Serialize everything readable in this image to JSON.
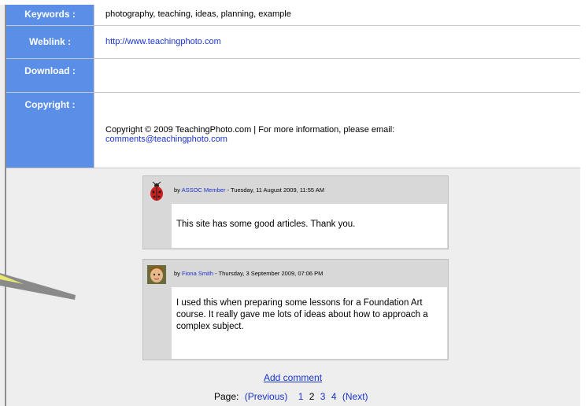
{
  "meta": {
    "rows": [
      {
        "key": "Keywords :",
        "value": "photography, teaching, ideas, planning, example"
      },
      {
        "key": "Weblink :",
        "value": "http://www.teachingphoto.com"
      },
      {
        "key": "Download :",
        "value": ""
      },
      {
        "key": "Copyright :",
        "value": "Copyright © 2009 TeachingPhoto.com | For more information, please email:",
        "link": "comments@teachingphoto.com"
      }
    ]
  },
  "comments": [
    {
      "by_prefix": "by",
      "author": "ASSOC Member",
      "date": " - Tuesday, 11 August 2009, 11:55 AM",
      "text": "This site has some good articles. Thank you.",
      "avatar_icon": "ladybug-avatar-icon"
    },
    {
      "by_prefix": "by",
      "author": "Fiona Smith",
      "date": " - Thursday, 3 September 2009, 07:06 PM",
      "text": "I used this when preparing some lessons for a Foundation Art course.  It really gave me lots of ideas about how to approach a complex subject.",
      "avatar_icon": "user-photo-avatar-icon"
    }
  ],
  "actions": {
    "add_comment": "Add comment"
  },
  "pager": {
    "label": "Page:",
    "previous": "(Previous)",
    "pages": [
      "1",
      "2",
      "3",
      "4"
    ],
    "next": "(Next)"
  },
  "colors": {
    "key_cell": "#5b8ee6",
    "link": "#1a33cc",
    "panel": "#eeeeee"
  }
}
